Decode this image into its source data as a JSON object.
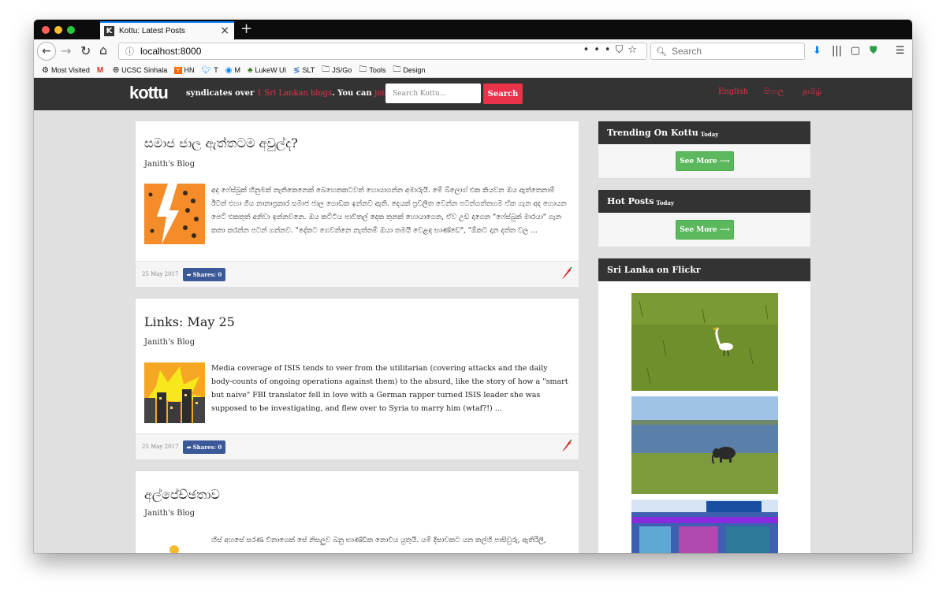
{
  "browser": {
    "tab_title": "Kottu: Latest Posts",
    "tab_favicon": "K",
    "url": "localhost:8000",
    "search_placeholder": "Search",
    "bookmarks": [
      {
        "label": "Most Visited",
        "icon": "gear-icon"
      },
      {
        "label": "",
        "icon": "gmail-icon"
      },
      {
        "label": "UCSC Sinhala",
        "icon": "globe-icon"
      },
      {
        "label": "HN",
        "icon": "hn-icon"
      },
      {
        "label": "T",
        "icon": "twitter-icon"
      },
      {
        "label": "M",
        "icon": "messenger-icon"
      },
      {
        "label": "LukeW UI",
        "icon": "lukew-icon"
      },
      {
        "label": "SLT",
        "icon": "slt-icon"
      },
      {
        "label": "JS/Go",
        "icon": "folder-icon"
      },
      {
        "label": "Tools",
        "icon": "folder-icon"
      },
      {
        "label": "Design",
        "icon": "folder-icon"
      }
    ]
  },
  "site": {
    "logo": "kottu",
    "tagline_pre": "syndicates over ",
    "tagline_link1": "1 Sri Lankan blogs",
    "tagline_mid": ". You can ",
    "tagline_link2": "join too",
    "tagline_end": ".",
    "search_placeholder": "Search Kottu...",
    "search_button": "Search",
    "languages": [
      "English",
      "සිංහල",
      "தமிழ்"
    ],
    "accent_color": "#e8334a",
    "header_color": "#333333"
  },
  "posts": [
    {
      "title": "සමාජ ජාල ඇත්තටම අවුල්ද?",
      "blog": "Janith's Blog",
      "excerpt": "අද ෆේස්බුක් හිනුමක් නැතිකෙනෙක් බෙහෙතකටවත් හොයාගන්න අමාරුයි. මේ බ්ලොග් එක කියවන ඔය ඇත්තෙනාම් ඊටත් එහා ගිය නානාප්‍රකාර සමාජ ජාල ගොඩක ඉන්නව ඇති. දෙයක් ප්‍රචලිත වෙන්න පටන්ගත්තහම ඒක ගැන අද හොයන පෙට් එකතුත් අනිවා ඉන්නවනෙ. ඔය කට්ටිය පාවිතල් දෙක තුනක් හොයාගෙන, ඒව උඩ දාගෙන \"ෆේස්බුක් මාරයා\" ගැන කතා කරන්න පටන් ගන්නව. \"දේකට ගෙවන්නෙ නැත්තම් ඔයා තමයි වෙළඳ භාණ්ඩෙ\", \"ඕකට දාන දත්ත වල ...",
      "date": "25 May 2017",
      "shares": "Shares: 0"
    },
    {
      "title": "Links: May 25",
      "blog": "Janith's Blog",
      "excerpt": "Media coverage of ISIS tends to veer from the utilitarian (covering attacks and the daily body-counts of ongoing operations against them) to the absurd, like the story of how a \"smart but naive\" FBI translator fell in love with a German rapper turned ISIS leader she was supposed to be investigating, and flew over to Syria to marry him (wtaf?!) ...",
      "date": "25 May 2017",
      "shares": "Shares: 0"
    },
    {
      "title": "අල්පේච්ඡතාව",
      "blog": "Janith's Blog",
      "excerpt": "හිස් අහසේ සරණ විනාශෙක් සේ නිසලුව බනු භාණ්ඩික නොවිය යුතුයි. යම් දිසාවකට යන කල්හි පාසිවුරු, ඇතිරිලි,",
      "date": "",
      "shares": ""
    }
  ],
  "sidebar": {
    "trending_title": "Trending On Kottu",
    "trending_sub": "Today",
    "trending_more": "See More ⟶",
    "hot_title": "Hot Posts",
    "hot_sub": "Today",
    "hot_more": "See More ⟶",
    "flickr_title": "Sri Lanka on Flickr",
    "flickr_images": [
      "white-egret-in-grass",
      "elephant-by-lake",
      "samsung-shop-front"
    ]
  },
  "colors": {
    "share_button": "#3b5998",
    "see_more": "#5cb85c"
  }
}
